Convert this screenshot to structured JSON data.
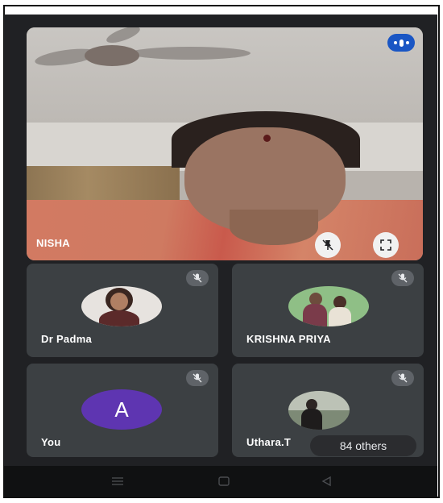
{
  "main_speaker": {
    "name": "NISHA"
  },
  "participants": [
    {
      "name": "Dr Padma"
    },
    {
      "name": "KRISHNA PRIYA"
    },
    {
      "name": "You",
      "initial": "A"
    },
    {
      "name": "Uthara.T"
    }
  ],
  "others_label": "84 others",
  "icons": {
    "more": "more-options-icon",
    "pin": "unpin-icon",
    "fullscreen": "fullscreen-icon",
    "muted": "mic-off-icon",
    "nav_recents": "recents-icon",
    "nav_home": "home-icon",
    "nav_back": "back-icon"
  },
  "colors": {
    "background": "#202124",
    "tile": "#3c4043",
    "accent": "#1a56c4",
    "you_avatar": "#5e35b1"
  }
}
